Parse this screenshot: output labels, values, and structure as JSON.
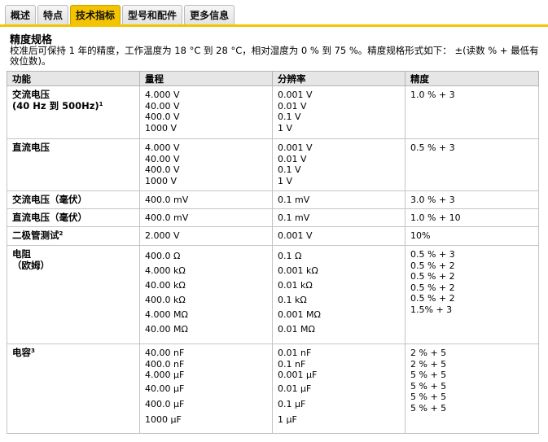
{
  "tabs": [
    {
      "label": "概述",
      "active": false
    },
    {
      "label": "特点",
      "active": false
    },
    {
      "label": "技术指标",
      "active": true
    },
    {
      "label": "型号和配件",
      "active": false
    },
    {
      "label": "更多信息",
      "active": false
    }
  ],
  "section": {
    "title": "精度规格",
    "description": "校准后可保持 1 年的精度，工作温度为 18 °C 到 28 °C，相对湿度为 0 % 到 75 %。精度规格形式如下： ±(读数 % + 最低有效位数)。"
  },
  "table": {
    "headers": [
      "功能",
      "量程",
      "分辨率",
      "精度"
    ],
    "rows": [
      {
        "func": "交流电压",
        "func2": "(40 Hz 到 500Hz)",
        "sup": "1",
        "range": [
          "4.000 V",
          "40.00 V",
          "400.0 V",
          "1000 V"
        ],
        "res": [
          "0.001 V",
          "0.01 V",
          "0.1 V",
          "1 V"
        ],
        "acc": [
          "1.0 % + 3"
        ]
      },
      {
        "func": "直流电压",
        "func2": "",
        "sup": "",
        "range": [
          "4.000 V",
          "40.00 V",
          "400.0 V",
          "1000 V"
        ],
        "res": [
          "0.001 V",
          "0.01 V",
          "0.1 V",
          "1 V"
        ],
        "acc": [
          "0.5 % + 3"
        ]
      },
      {
        "func": "交流电压（毫伏）",
        "func2": "",
        "sup": "",
        "range": [
          "400.0 mV"
        ],
        "res": [
          "0.1 mV"
        ],
        "acc": [
          "3.0 % + 3"
        ]
      },
      {
        "func": "直流电压（毫伏）",
        "func2": "",
        "sup": "",
        "range": [
          "400.0 mV"
        ],
        "res": [
          "0.1 mV"
        ],
        "acc": [
          "1.0 % + 10"
        ]
      },
      {
        "func": "二极管测试",
        "func2": "",
        "sup": "2",
        "range": [
          "2.000 V"
        ],
        "res": [
          "0.001 V"
        ],
        "acc": [
          "10%"
        ]
      },
      {
        "func": "电阻",
        "func2": "（欧姆）",
        "sup": "",
        "range": [
          "400.0 Ω",
          "4.000 kΩ",
          "40.00 kΩ",
          "400.0 kΩ",
          "4.000 MΩ",
          "40.00 MΩ"
        ],
        "res": [
          "0.1 Ω",
          "0.001 kΩ",
          "0.01 kΩ",
          "0.1 kΩ",
          "0.001 MΩ",
          "0.01 MΩ"
        ],
        "acc": [
          "0.5 % + 3",
          "0.5 % + 2",
          "0.5 % + 2",
          "0.5 % + 2",
          "0.5 % + 2",
          "1.5% + 3"
        ]
      },
      {
        "func": "电容",
        "func2": "",
        "sup": "3",
        "range": [
          "40.00 nF",
          "400.0 nF",
          "4.000 μF",
          "40.00 μF",
          "400.0 μF",
          "1000 μF"
        ],
        "res": [
          "0.01 nF",
          "0.1 nF",
          "0.001 μF",
          "0.01 μF",
          "0.1 μF",
          "1 μF"
        ],
        "acc": [
          "2 % + 5",
          "2 % + 5",
          "5 % + 5",
          "5 % + 5",
          "5 % + 5",
          "5 % + 5"
        ]
      }
    ]
  }
}
